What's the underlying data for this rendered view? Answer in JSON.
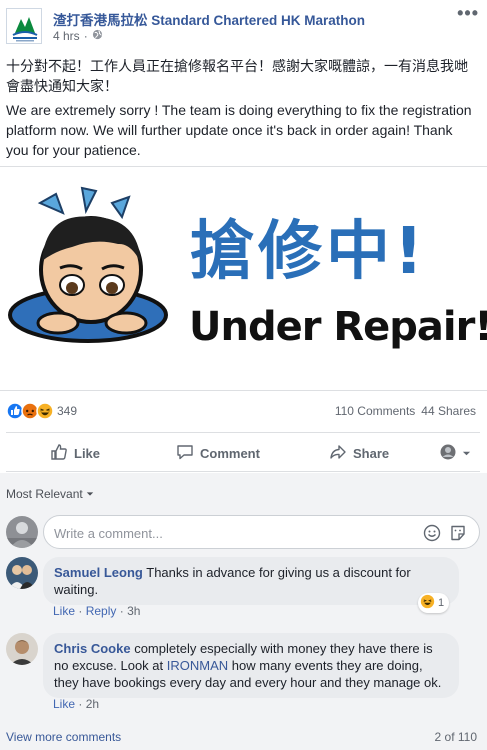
{
  "post": {
    "page_name": "渣打香港馬拉松 Standard Chartered HK Marathon",
    "time": "4 hrs",
    "more_icon": "more-horizontal-icon",
    "text_zh": "十分對不起！工作人員正在搶修報名平台！感謝大家嘅體諒，一有消息我哋會盡快通知大家！",
    "text_en": "We are extremely sorry ! The team is doing everything to fix the registration platform now. We will further update once it's back in order again! Thank you for your patience.",
    "image": {
      "heading_zh": "搶修中!",
      "heading_en": "Under Repair!"
    }
  },
  "reactions": {
    "count": "349",
    "icons": [
      "like-reaction-icon",
      "angry-reaction-icon",
      "haha-reaction-icon"
    ],
    "comments": "110 Comments",
    "shares": "44 Shares"
  },
  "actions": {
    "like": "Like",
    "comment": "Comment",
    "share": "Share"
  },
  "comments": {
    "sort_label": "Most Relevant",
    "placeholder": "Write a comment...",
    "items": [
      {
        "author": "Samuel Leong",
        "text_line1": "Thanks in advance for giving us a discount for",
        "text_line2": "waiting.",
        "like": "Like",
        "reply": "Reply",
        "time": "3h",
        "reaction_count": "1"
      },
      {
        "author": "Chris Cooke",
        "text_part1": "completely especially with money they have there is",
        "text_part2": "no excuse. Look at",
        "link": "IRONMAN",
        "text_part3": "how many events they are doing,",
        "text_line3": "they have bookings every day and every hour and they manage ok.",
        "like": "Like",
        "time": "2h"
      }
    ],
    "view_more": "View more comments",
    "pagination": "2 of 110"
  },
  "colors": {
    "link": "#385898",
    "repair_blue": "#2a6fb8",
    "comment_bg": "#f2f3f5"
  }
}
